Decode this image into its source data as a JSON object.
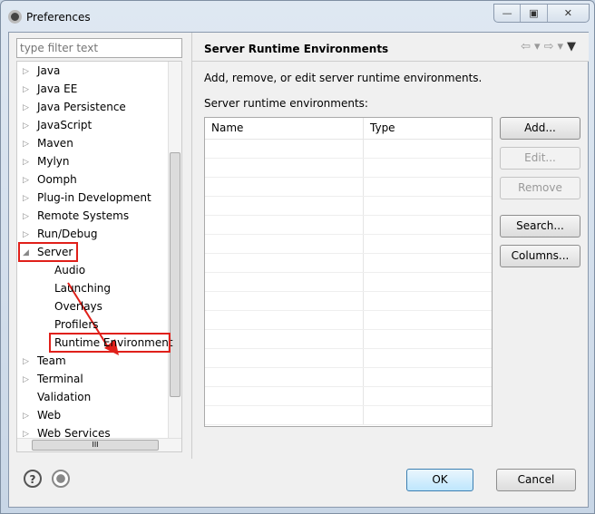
{
  "window": {
    "title": "Preferences",
    "controls": [
      "—",
      "▣",
      "✕"
    ]
  },
  "filter": {
    "placeholder": "type filter text"
  },
  "tree": [
    {
      "label": "Java",
      "level": 0,
      "expandable": true
    },
    {
      "label": "Java EE",
      "level": 0,
      "expandable": true
    },
    {
      "label": "Java Persistence",
      "level": 0,
      "expandable": true
    },
    {
      "label": "JavaScript",
      "level": 0,
      "expandable": true
    },
    {
      "label": "Maven",
      "level": 0,
      "expandable": true
    },
    {
      "label": "Mylyn",
      "level": 0,
      "expandable": true
    },
    {
      "label": "Oomph",
      "level": 0,
      "expandable": true
    },
    {
      "label": "Plug-in Development",
      "level": 0,
      "expandable": true
    },
    {
      "label": "Remote Systems",
      "level": 0,
      "expandable": true
    },
    {
      "label": "Run/Debug",
      "level": 0,
      "expandable": true
    },
    {
      "label": "Server",
      "level": 0,
      "expandable": true,
      "expanded": true,
      "highlighted": true
    },
    {
      "label": "Audio",
      "level": 1
    },
    {
      "label": "Launching",
      "level": 1
    },
    {
      "label": "Overlays",
      "level": 1
    },
    {
      "label": "Profilers",
      "level": 1
    },
    {
      "label": "Runtime Environment",
      "level": 1,
      "highlighted": true
    },
    {
      "label": "Team",
      "level": 0,
      "expandable": true
    },
    {
      "label": "Terminal",
      "level": 0,
      "expandable": true
    },
    {
      "label": "Validation",
      "level": 0
    },
    {
      "label": "Web",
      "level": 0,
      "expandable": true
    },
    {
      "label": "Web Services",
      "level": 0,
      "expandable": true
    }
  ],
  "page": {
    "title": "Server Runtime Environments",
    "description": "Add, remove, or edit server runtime environments.",
    "list_label": "Server runtime environments:",
    "columns": [
      "Name",
      "Type"
    ],
    "buttons": {
      "add": "Add...",
      "edit": "Edit...",
      "remove": "Remove",
      "search": "Search...",
      "columns": "Columns..."
    }
  },
  "footer": {
    "ok": "OK",
    "cancel": "Cancel",
    "help_icon": "?"
  },
  "annotation_color": "#e0201a"
}
